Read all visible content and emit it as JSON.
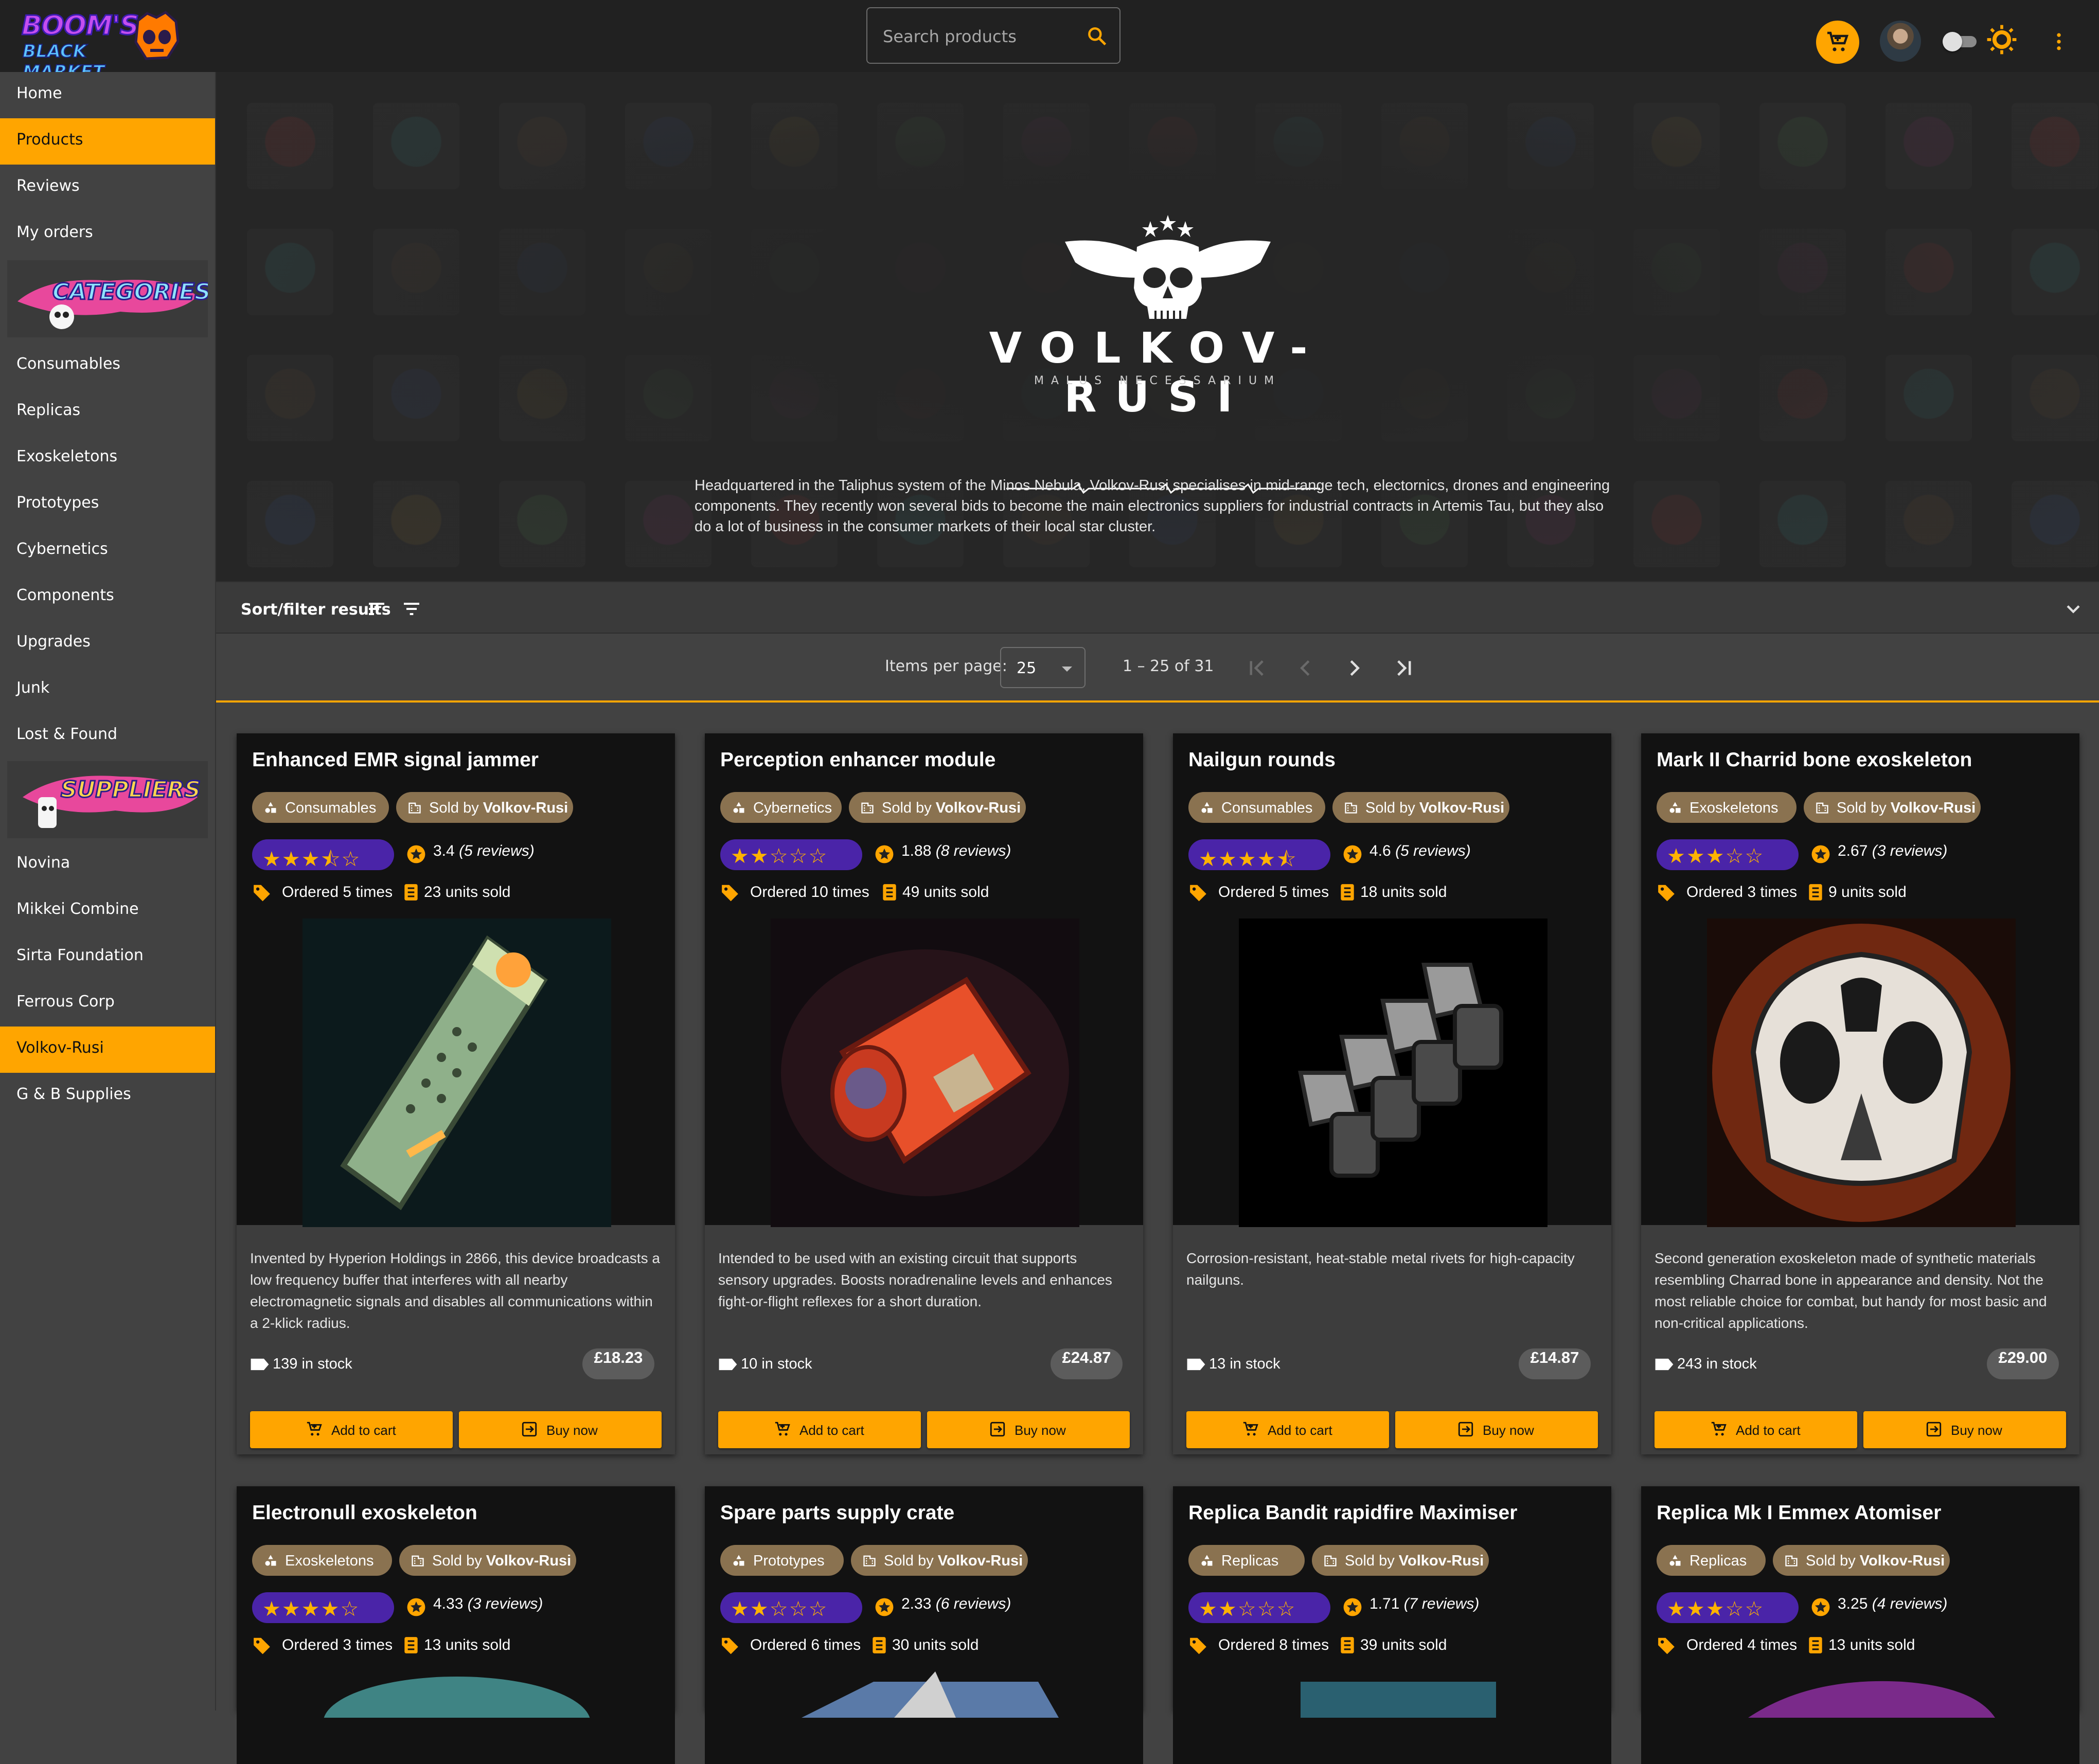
{
  "header": {
    "logo_line1": "BOOM'S",
    "logo_line2": "BLACK MARKET",
    "search_placeholder": "Search products"
  },
  "sidebar": {
    "items": [
      {
        "label": "Home"
      },
      {
        "label": "Products",
        "active": true
      },
      {
        "label": "Reviews"
      },
      {
        "label": "My orders"
      }
    ],
    "categories_banner": "CATEGORIES",
    "categories": [
      {
        "label": "Consumables"
      },
      {
        "label": "Replicas"
      },
      {
        "label": "Exoskeletons"
      },
      {
        "label": "Prototypes"
      },
      {
        "label": "Cybernetics"
      },
      {
        "label": "Components"
      },
      {
        "label": "Upgrades"
      },
      {
        "label": "Junk"
      },
      {
        "label": "Lost & Found"
      }
    ],
    "suppliers_banner": "SUPPLIERS",
    "suppliers": [
      {
        "label": "Novina"
      },
      {
        "label": "Mikkei Combine"
      },
      {
        "label": "Sirta Foundation"
      },
      {
        "label": "Ferrous Corp"
      },
      {
        "label": "Volkov-Rusi",
        "active": true
      },
      {
        "label": "G & B Supplies"
      }
    ]
  },
  "hero": {
    "brand": "VOLKOV-RUSI",
    "tagline": "MALUS NECESSARIUM",
    "description": "Headquartered in the Taliphus system of the Minos Nebula, Volkov-Rusi specialises in mid-range tech, electornics, drones and engineering components. They recently won several bids to become the main electronics suppliers for industrial contracts in Artemis Tau, but they also do a lot of business in the consumer markets of their local star cluster."
  },
  "filter": {
    "label": "Sort/filter results"
  },
  "paginator": {
    "items_per_page_label": "Items per page:",
    "items_per_page": "25",
    "range": "1 – 25 of 31"
  },
  "accent_color": "#ffa500",
  "rating_color": "#4a24a8",
  "products": [
    {
      "title": "Enhanced EMR signal jammer",
      "category": "Consumables",
      "sold_by_prefix": "Sold by",
      "supplier": "Volkov-Rusi",
      "stars": "★★★⯪☆",
      "rating": "3.4",
      "reviews": "(5 reviews)",
      "ordered": "Ordered 5 times",
      "sold": "23 units sold",
      "description": "Invented by Hyperion Holdings in 2866, this device broadcasts a low frequency buffer that interferes with all nearby electromagnetic signals and disables all communications within a 2-klick radius.",
      "stock": "139 in stock",
      "price": "£18.23",
      "add_to_cart": "Add to cart",
      "buy_now": "Buy now"
    },
    {
      "title": "Perception enhancer module",
      "category": "Cybernetics",
      "sold_by_prefix": "Sold by",
      "supplier": "Volkov-Rusi",
      "stars": "★★☆☆☆",
      "rating": "1.88",
      "reviews": "(8 reviews)",
      "ordered": "Ordered 10 times",
      "sold": "49 units sold",
      "description": "Intended to be used with an existing circuit that supports sensory upgrades. Boosts noradrenaline levels and enhances fight-or-flight reflexes for a short duration.",
      "stock": "10 in stock",
      "price": "£24.87",
      "add_to_cart": "Add to cart",
      "buy_now": "Buy now"
    },
    {
      "title": "Nailgun rounds",
      "category": "Consumables",
      "sold_by_prefix": "Sold by",
      "supplier": "Volkov-Rusi",
      "stars": "★★★★⯪",
      "rating": "4.6",
      "reviews": "(5 reviews)",
      "ordered": "Ordered 5 times",
      "sold": "18 units sold",
      "description": "Corrosion-resistant, heat-stable metal rivets for high-capacity nailguns.",
      "stock": "13 in stock",
      "price": "£14.87",
      "add_to_cart": "Add to cart",
      "buy_now": "Buy now"
    },
    {
      "title": "Mark II Charrid bone exoskeleton",
      "category": "Exoskeletons",
      "sold_by_prefix": "Sold by",
      "supplier": "Volkov-Rusi",
      "stars": "★★★☆☆",
      "rating": "2.67",
      "reviews": "(3 reviews)",
      "ordered": "Ordered 3 times",
      "sold": "9 units sold",
      "description": "Second generation exoskeleton made of synthetic materials resembling Charrad bone in appearance and density. Not the most reliable choice for combat, but handy for most basic and non-critical applications.",
      "stock": "243 in stock",
      "price": "£29.00",
      "add_to_cart": "Add to cart",
      "buy_now": "Buy now"
    },
    {
      "title": "Electronull exoskeleton",
      "category": "Exoskeletons",
      "sold_by_prefix": "Sold by",
      "supplier": "Volkov-Rusi",
      "stars": "★★★★☆",
      "rating": "4.33",
      "reviews": "(3 reviews)",
      "ordered": "Ordered 3 times",
      "sold": "13 units sold"
    },
    {
      "title": "Spare parts supply crate",
      "category": "Prototypes",
      "sold_by_prefix": "Sold by",
      "supplier": "Volkov-Rusi",
      "stars": "★★☆☆☆",
      "rating": "2.33",
      "reviews": "(6 reviews)",
      "ordered": "Ordered 6 times",
      "sold": "30 units sold"
    },
    {
      "title": "Replica Bandit rapidfire Maximiser",
      "category": "Replicas",
      "sold_by_prefix": "Sold by",
      "supplier": "Volkov-Rusi",
      "stars": "★★☆☆☆",
      "rating": "1.71",
      "reviews": "(7 reviews)",
      "ordered": "Ordered 8 times",
      "sold": "39 units sold"
    },
    {
      "title": "Replica Mk I Emmex Atomiser",
      "category": "Replicas",
      "sold_by_prefix": "Sold by",
      "supplier": "Volkov-Rusi",
      "stars": "★★★☆☆",
      "rating": "3.25",
      "reviews": "(4 reviews)",
      "ordered": "Ordered 4 times",
      "sold": "13 units sold"
    }
  ]
}
